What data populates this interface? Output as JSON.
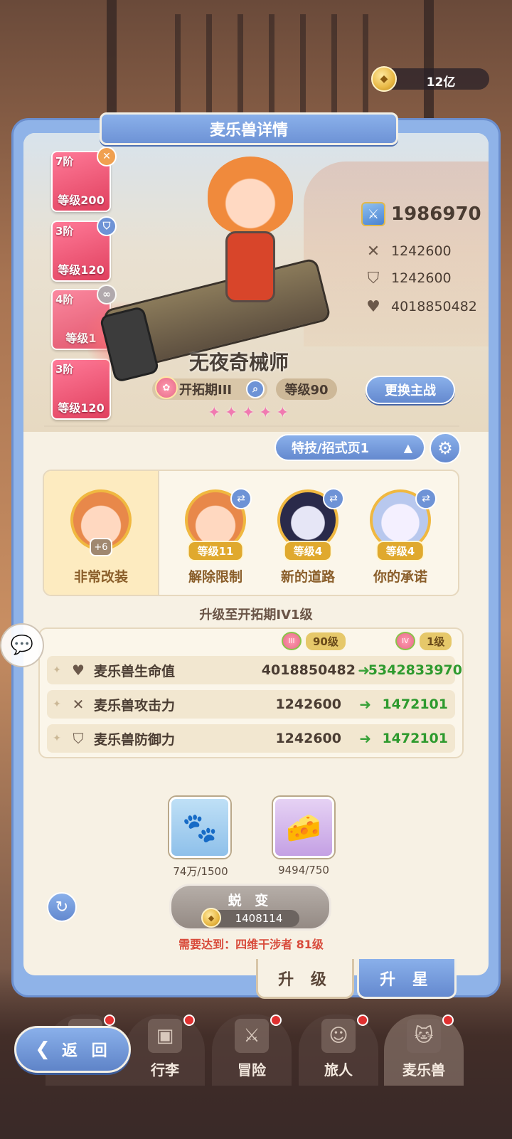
{
  "currency": {
    "value": "12亿",
    "icon": "coin-icon"
  },
  "panel": {
    "title": "麦乐兽详情"
  },
  "ranks": [
    {
      "tier": "7阶",
      "level": "等级200",
      "badge": "sword-cross-icon",
      "badge_color": "#f0a050"
    },
    {
      "tier": "3阶",
      "level": "等级120",
      "badge": "shield-icon",
      "badge_color": "#6e93d6"
    },
    {
      "tier": "4阶",
      "level": "等级1",
      "badge": "link-icon",
      "badge_color": "#a8a0a8"
    },
    {
      "tier": "3阶",
      "level": "等级120"
    }
  ],
  "hero": {
    "name": "无夜奇械师",
    "power": "1986970",
    "attack": "1242600",
    "defense": "1242600",
    "hp": "4018850482",
    "tier": "开拓期III",
    "level": "等级90",
    "stars": 5,
    "swap_main": "更换主战"
  },
  "skill_page": {
    "label": "特技/招式页1"
  },
  "skills": [
    {
      "name": "非常改装",
      "plus": "+6"
    },
    {
      "name": "解除限制",
      "level": "等级11"
    },
    {
      "name": "新的道路",
      "level": "等级4"
    },
    {
      "name": "你的承诺",
      "level": "等级4"
    }
  ],
  "upgrade": {
    "title": "升级至开拓期IV1级",
    "from_level": "90级",
    "to_level": "1级",
    "rows": [
      {
        "label": "麦乐兽生命值",
        "from": "4018850482",
        "to": "5342833970",
        "icon": "heart-icon"
      },
      {
        "label": "麦乐兽攻击力",
        "from": "1242600",
        "to": "1472101",
        "icon": "sword-cross-icon"
      },
      {
        "label": "麦乐兽防御力",
        "from": "1242600",
        "to": "1472101",
        "icon": "shield-icon"
      }
    ]
  },
  "materials": [
    {
      "count": "74万/1500",
      "icon": "pet-food-bag-icon"
    },
    {
      "count": "9494/750",
      "icon": "cheese-icon"
    }
  ],
  "evolve": {
    "label": "蜕 变",
    "cost": "1408114"
  },
  "requirement": "需要达到：四维干涉者 81级",
  "tabs": {
    "upgrade": "升 级",
    "star": "升 星"
  },
  "nav": {
    "back": "返 回",
    "items": [
      "行李",
      "冒险",
      "旅人",
      "麦乐兽"
    ]
  },
  "colors": {
    "accent_blue": "#6e93d6",
    "gain_green": "#2e9a2e",
    "warning_red": "#d84a3a"
  }
}
